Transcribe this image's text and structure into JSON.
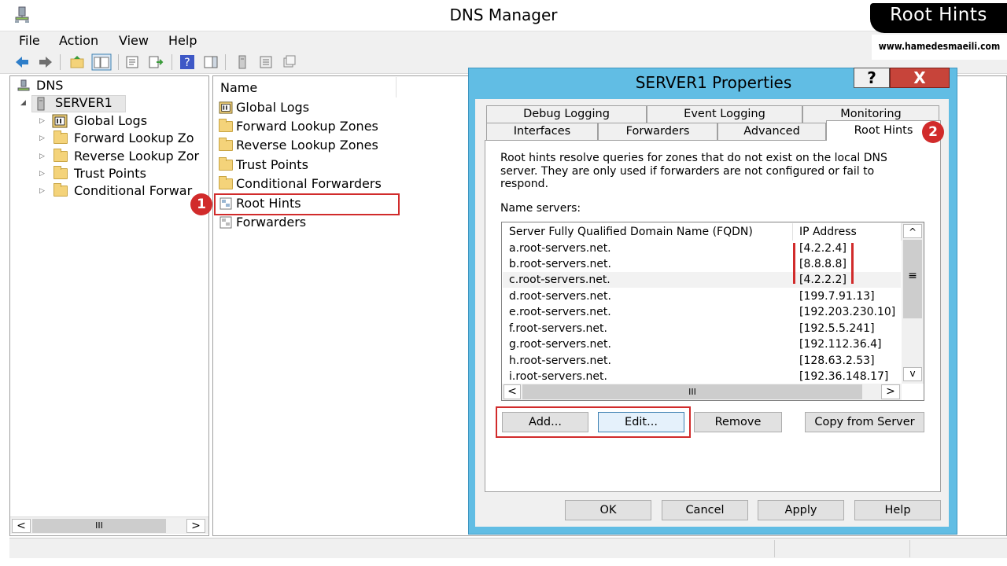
{
  "app": {
    "title": "DNS Manager"
  },
  "menu": [
    "File",
    "Action",
    "View",
    "Help"
  ],
  "tree": {
    "root": "DNS",
    "server": "SERVER1",
    "children": [
      "Global Logs",
      "Forward Lookup Zo",
      "Reverse Lookup Zor",
      "Trust Points",
      "Conditional Forwar"
    ]
  },
  "tree_scroll": {
    "left": "<",
    "thumb": "III",
    "right": ">"
  },
  "list": {
    "column": "Name",
    "items": [
      "Global Logs",
      "Forward Lookup Zones",
      "Reverse Lookup Zones",
      "Trust Points",
      "Conditional Forwarders",
      "Root Hints",
      "Forwarders"
    ]
  },
  "dialog": {
    "title": "SERVER1 Properties",
    "help_label": "?",
    "close_label": "X",
    "tabs_row1": [
      "Debug Logging",
      "Event Logging",
      "Monitoring"
    ],
    "tabs_row2": [
      "Interfaces",
      "Forwarders",
      "Advanced",
      "Root Hints"
    ],
    "active_tab": "Root Hints",
    "description": "Root hints resolve queries for zones that do not exist on the local DNS server.   They are only used if forwarders are not configured or fail to respond.",
    "name_servers_label": "Name servers:",
    "columns": [
      "Server Fully Qualified Domain Name (FQDN)",
      "IP Address"
    ],
    "servers": [
      {
        "fqdn": "a.root-servers.net.",
        "ip": "[4.2.2.4]"
      },
      {
        "fqdn": "b.root-servers.net.",
        "ip": "[8.8.8.8]"
      },
      {
        "fqdn": "c.root-servers.net.",
        "ip": "[4.2.2.2]"
      },
      {
        "fqdn": "d.root-servers.net.",
        "ip": "[199.7.91.13]"
      },
      {
        "fqdn": "e.root-servers.net.",
        "ip": "[192.203.230.10]"
      },
      {
        "fqdn": "f.root-servers.net.",
        "ip": "[192.5.5.241]"
      },
      {
        "fqdn": "g.root-servers.net.",
        "ip": "[192.112.36.4]"
      },
      {
        "fqdn": "h.root-servers.net.",
        "ip": "[128.63.2.53]"
      },
      {
        "fqdn": "i.root-servers.net.",
        "ip": "[192.36.148.17]"
      }
    ],
    "scroll": {
      "up": "^",
      "mid": "≡",
      "down": "v",
      "left": "<",
      "thumb": "III",
      "right": ">"
    },
    "buttons": {
      "add": "Add...",
      "edit": "Edit...",
      "remove": "Remove",
      "copy": "Copy from Server"
    },
    "footer": {
      "ok": "OK",
      "cancel": "Cancel",
      "apply": "Apply",
      "help": "Help"
    }
  },
  "annotations": {
    "badge1": "1",
    "badge2": "2"
  },
  "brand": {
    "title": "Root Hints",
    "url": "www.hamedesmaeili.com"
  },
  "colors": {
    "dialog_frame": "#61bde4",
    "highlight": "#d12b2b"
  }
}
